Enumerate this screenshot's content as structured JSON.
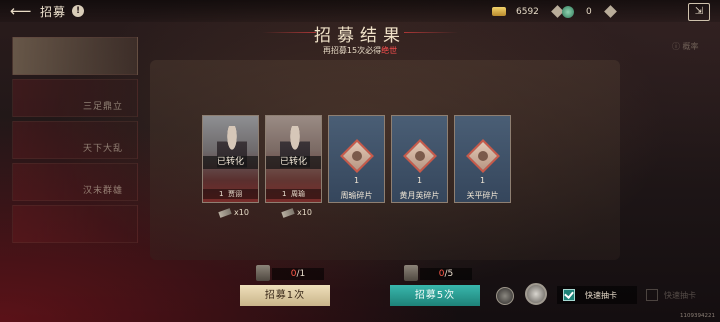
{
  "topbar": {
    "back_icon": "back-arrow-icon",
    "title": "招募",
    "info_glyph": "!",
    "gold": "6592",
    "jade": "0",
    "menu_glyph": "⇲"
  },
  "result": {
    "title": "招募结果",
    "subtitle_pre": "再招募15次必得",
    "subtitle_highlight": "绝世",
    "subtitle_color": "#ff4f4f"
  },
  "sidebar": {
    "items": [
      {
        "label": ""
      },
      {
        "label": "三足鼎立"
      },
      {
        "label": "天下大乱"
      },
      {
        "label": "汉末群雄"
      },
      {
        "label": ""
      }
    ],
    "right_faint": "ⓘ 概率"
  },
  "cards": [
    {
      "type": "hero",
      "status": "已转化",
      "count": "1",
      "name": "贾诩",
      "tokens": "x10"
    },
    {
      "type": "hero",
      "status": "已转化",
      "count": "1",
      "name": "周瑜",
      "tokens": "x10"
    },
    {
      "type": "fragment",
      "count": "1",
      "name": "周瑜碎片"
    },
    {
      "type": "fragment",
      "count": "1",
      "name": "黄月英碎片"
    },
    {
      "type": "fragment",
      "count": "1",
      "name": "关平碎片"
    }
  ],
  "bottom": {
    "count1_cur": "0",
    "count1_total": "/1",
    "count5_cur": "0",
    "count5_total": "/5",
    "btn1": "招募1次",
    "btn5": "招募5次",
    "quick_draw": "快速抽卡",
    "quick_draw2": "快速抽卡",
    "uid": "1109394221"
  }
}
